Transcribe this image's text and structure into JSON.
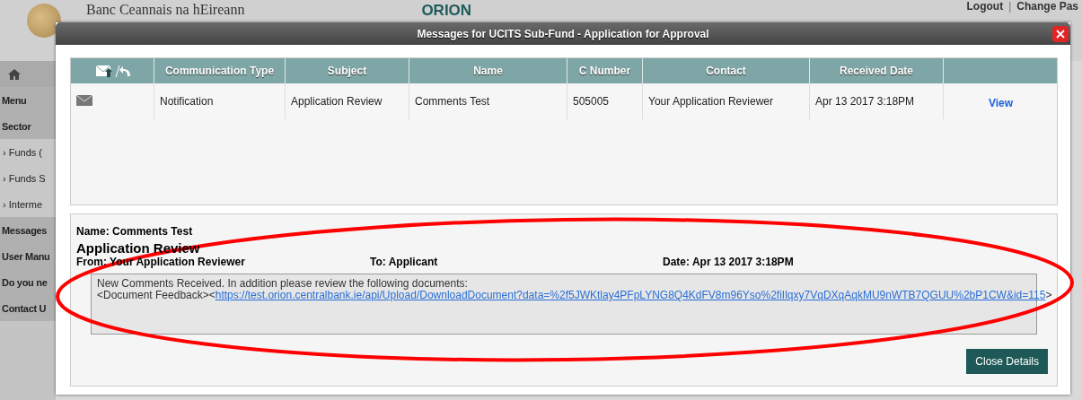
{
  "header": {
    "bank_name": "Banc Ceannais na hEireann",
    "app_name": "ORION",
    "links": [
      {
        "kind": "link",
        "label": "Logout"
      },
      {
        "kind": "separator",
        "label": "|"
      },
      {
        "kind": "link",
        "label": "Change Pas"
      }
    ]
  },
  "sidebar": {
    "items": [
      {
        "kind": "home"
      },
      {
        "kind": "section",
        "label": "Menu"
      },
      {
        "kind": "section",
        "label": "Sector"
      },
      {
        "kind": "link",
        "label": "› Funds ("
      },
      {
        "kind": "link",
        "label": "› Funds S"
      },
      {
        "kind": "link",
        "label": "› Interme"
      },
      {
        "kind": "section",
        "label": "Messages"
      },
      {
        "kind": "section",
        "label": "User Manu"
      },
      {
        "kind": "section",
        "label": "Do you ne"
      },
      {
        "kind": "section",
        "label": "Contact U"
      }
    ]
  },
  "modal": {
    "title": "Messages for UCITS Sub-Fund - Application for Approval",
    "table": {
      "columns": [
        "Communication Type",
        "Subject",
        "Name",
        "C Number",
        "Contact",
        "Received Date"
      ],
      "rows": [
        {
          "cells": [
            "Notification",
            "Application Review",
            "Comments Test",
            "505005",
            "Your Application Reviewer",
            "Apr 13 2017 3:18PM"
          ],
          "action": "View"
        }
      ]
    },
    "detail": {
      "name": "Name: Comments Test",
      "subject": "Application Review",
      "from": "From: Your Application Reviewer",
      "to": "To: Applicant",
      "date": "Date: Apr 13 2017 3:18PM",
      "message": {
        "text": "New Comments Received. In addition please review the following documents:",
        "prefix": "<Document Feedback><",
        "link": "https://test.orion.centralbank.ie/api/Upload/DownloadDocument?data=%2f5JWKtlay4PFpLYNG8Q4KdFV8m96Yso%2fiIlqxy7VqDXqAqkMU9nWTB7QGUU%2bP1CW&id=115",
        "suffix": ">"
      }
    },
    "close_button": "Close Details"
  }
}
